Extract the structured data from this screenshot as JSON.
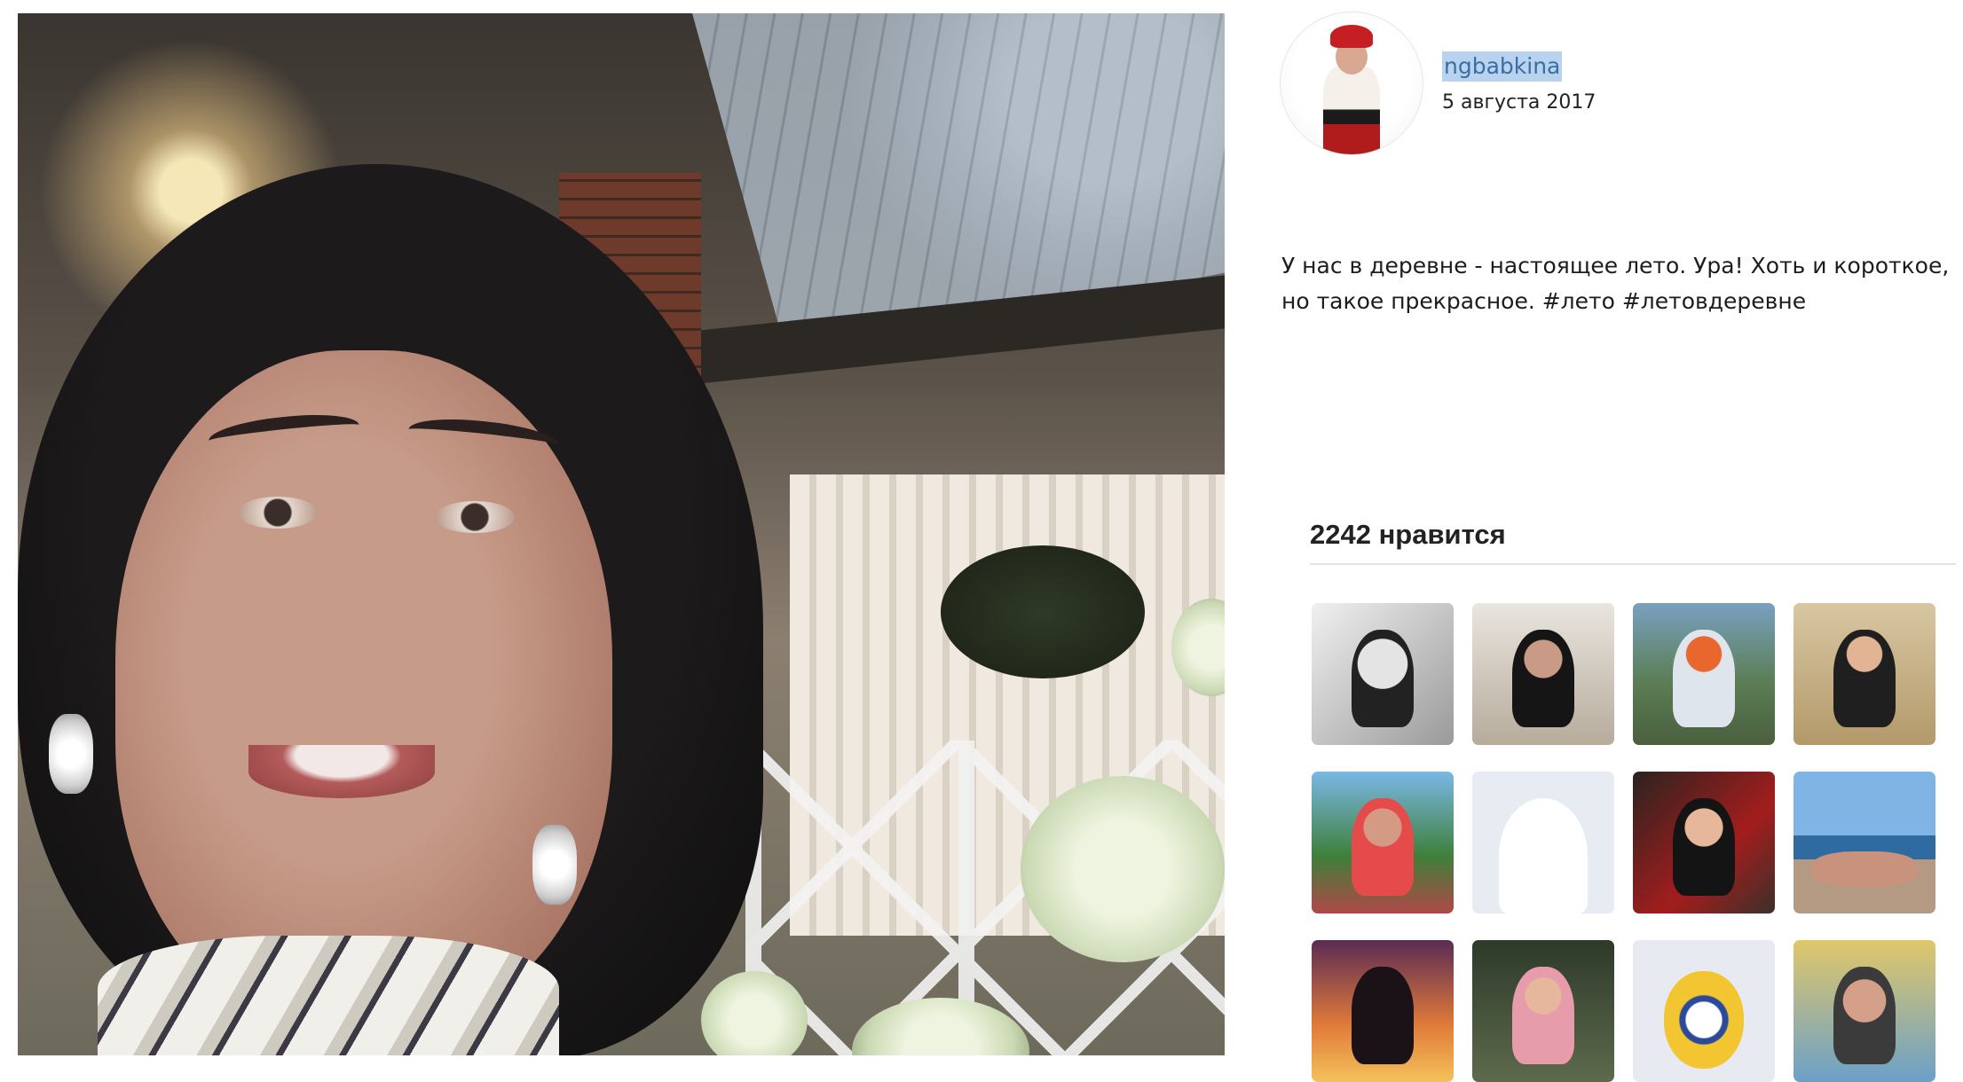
{
  "post": {
    "photo_alt": "selfie photo",
    "username": "ngbabkina",
    "date": "5 августа 2017",
    "caption": "У нас в деревне - настоящее лето. Ура! Хоть и короткое, но такое прекрасное. #лето #летовдеревне"
  },
  "likes": {
    "title": "2242 нравится",
    "users": [
      {
        "icon": "user-avatar"
      },
      {
        "icon": "user-avatar"
      },
      {
        "icon": "user-avatar"
      },
      {
        "icon": "user-avatar"
      },
      {
        "icon": "user-avatar"
      },
      {
        "icon": "default-avatar-icon"
      },
      {
        "icon": "user-avatar"
      },
      {
        "icon": "user-avatar"
      },
      {
        "icon": "user-avatar"
      },
      {
        "icon": "user-avatar"
      },
      {
        "icon": "real-madrid-logo"
      },
      {
        "icon": "user-avatar"
      }
    ]
  },
  "colors": {
    "username_link": "#3a6ea5",
    "selection_highlight": "#b9d3ee",
    "text": "#1d1d1d"
  }
}
